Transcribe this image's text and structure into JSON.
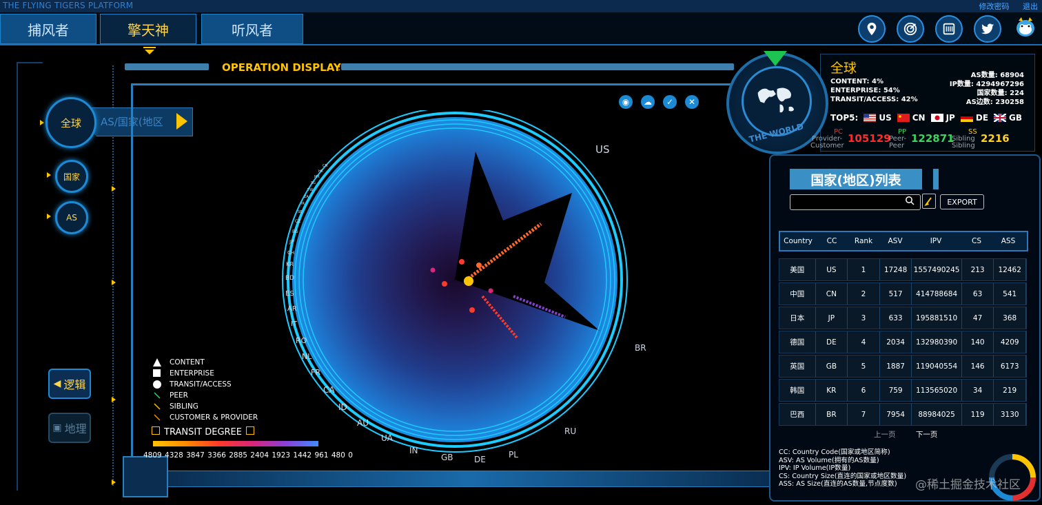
{
  "header": {
    "platform_title": "THE FLYING TIGERS PLATFORM",
    "link_change_password": "修改密码",
    "link_logout": "退出"
  },
  "nav": {
    "tabs": [
      {
        "label": "捕风者",
        "active": false
      },
      {
        "label": "擎天神",
        "active": true
      },
      {
        "label": "听风者",
        "active": false
      }
    ],
    "icons": [
      "location-icon",
      "target-icon",
      "router-icon",
      "twitter-icon",
      "mascot-icon"
    ]
  },
  "left": {
    "scope_global": "全球",
    "scope_country": "国家",
    "scope_as": "AS",
    "as_panel_label": "AS/国家(地区",
    "logic_button": "逻辑",
    "geo_button": "地理"
  },
  "operation": {
    "title": "OPERATION DISPLAY"
  },
  "chart": {
    "country_labels_large": [
      "US",
      "BR",
      "RU",
      "PL",
      "DE",
      "GB",
      "IN",
      "UA",
      "AU",
      "ID",
      "CA",
      "FR",
      "NL",
      "RO",
      "IT",
      "AR",
      "ES",
      "BD",
      "KR",
      "CH",
      "JP",
      "BG",
      "CZ",
      "SE",
      "IR",
      "ZA",
      "TW",
      "SG",
      "MX",
      "HK",
      "CN"
    ],
    "legend": {
      "content": "CONTENT",
      "enterprise": "ENTERPRISE",
      "transit": "TRANSIT/ACCESS",
      "peer": "PEER",
      "sibling": "SIBLING",
      "customer_provider": "CUSTOMER & PROVIDER"
    },
    "transit_degree_title": "TRANSIT DEGREE",
    "transit_degree_ticks": "4809 4328 3847 3366 2885 2404 1923 1442 961  480  0"
  },
  "world": {
    "label": "THE WORLD",
    "title": "全球",
    "content": "CONTENT:  4%",
    "enterprise": "ENTERPRISE:  54%",
    "transit": "TRANSIT/ACCESS:  42%",
    "as_count": "AS数量:  68904",
    "ip_count": "IP数量:  4294967296",
    "country_count": "国家数量:  224",
    "as_edges": "AS边数:  230258",
    "top5_label": "TOP5:",
    "top5": [
      "US",
      "CN",
      "JP",
      "DE",
      "GB"
    ],
    "pc_abbr": "PC",
    "pc_label1": "Provider-",
    "pc_label2": "Customer",
    "pc_value": "105129",
    "pp_abbr": "PP",
    "pp_label1": "Peer-",
    "pp_label2": "Peer",
    "pp_value": "122871",
    "ss_abbr": "SS",
    "ss_label1": "Sibling",
    "ss_label2": "Sibling",
    "ss_value": "2216"
  },
  "country_list": {
    "title": "国家(地区)列表",
    "search_placeholder": "",
    "export_label": "EXPORT",
    "columns": [
      "Country",
      "CC",
      "Rank",
      "ASV",
      "IPV",
      "CS",
      "ASS"
    ],
    "rows": [
      [
        "美国",
        "US",
        "1",
        "17248",
        "1557490245",
        "213",
        "12462"
      ],
      [
        "中国",
        "CN",
        "2",
        "517",
        "414788684",
        "63",
        "541"
      ],
      [
        "日本",
        "JP",
        "3",
        "633",
        "195881510",
        "47",
        "368"
      ],
      [
        "德国",
        "DE",
        "4",
        "2034",
        "132980390",
        "140",
        "4209"
      ],
      [
        "英国",
        "GB",
        "5",
        "1887",
        "119040554",
        "146",
        "6173"
      ],
      [
        "韩国",
        "KR",
        "6",
        "759",
        "113565020",
        "34",
        "219"
      ],
      [
        "巴西",
        "BR",
        "7",
        "7954",
        "88984025",
        "119",
        "3130"
      ]
    ],
    "prev_page": "上一页",
    "next_page": "下一页",
    "notes": [
      "CC:  Country Code(国家或地区简称)",
      "ASV: AS Volume(拥有的AS数量)",
      "IPV: IP Volume(IP数量)",
      "CS: Country Size(直连的国家或地区数量)",
      "ASS: AS Size(直连的AS数量,节点度数)"
    ]
  },
  "watermark": "@稀土掘金技术社区",
  "colors": {
    "accent_blue": "#1d8ad6",
    "accent_gold": "#ffc400",
    "pc_red": "#ff2a2a",
    "pp_green": "#3bd45e",
    "ss_gold": "#ffd21f"
  }
}
